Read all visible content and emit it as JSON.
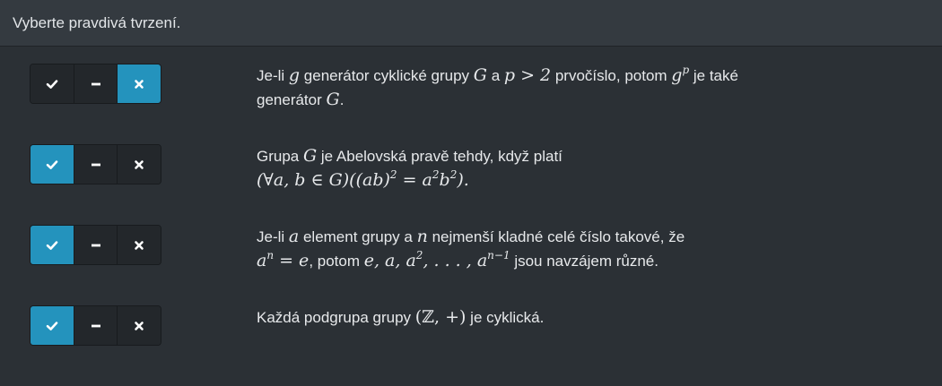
{
  "header": {
    "instruction": "Vyberte pravdivá tvrzení."
  },
  "colors": {
    "active_segment": "#2493bd",
    "segment": "#23272b",
    "background": "#2b3035"
  },
  "icons": {
    "true": "check-icon",
    "neutral": "minus-icon",
    "false": "times-icon"
  },
  "statements": [
    {
      "selected": "false",
      "t0": "Je-li ",
      "g": "g",
      "t1": " generátor cyklické grupy ",
      "G": "G",
      "t2": " a ",
      "cond": "p > 2",
      "t3": " prvočíslo, potom ",
      "gbase": "g",
      "gexp": "p",
      "t4": " je také",
      "t5": "generátor ",
      "G2": "G",
      "t6": "."
    },
    {
      "selected": "true",
      "t0": "Grupa ",
      "G": "G",
      "t1": " je Abelovská pravě tehdy, když platí",
      "f1": "(∀a, b ∈ G)((ab)",
      "f2": " = a",
      "f3": "b",
      "f4": ").",
      "exp": "2"
    },
    {
      "selected": "true",
      "t0": "Je-li ",
      "a": "a",
      "t1": " element grupy a ",
      "n": "n",
      "t2": " nejmenší kladné celé číslo takové, že",
      "an": "a",
      "anexp": "n",
      "eq": " = e",
      "t3": ", potom ",
      "seq1": "e, a, a",
      "seq1exp": "2",
      "seq2": ", . . . , a",
      "seq2exp": "n−1",
      "t4": " jsou navzájem různé."
    },
    {
      "selected": "true",
      "t0": "Každá podgrupa grupy ",
      "f": "(ℤ, +)",
      "t1": " je cyklická."
    }
  ]
}
